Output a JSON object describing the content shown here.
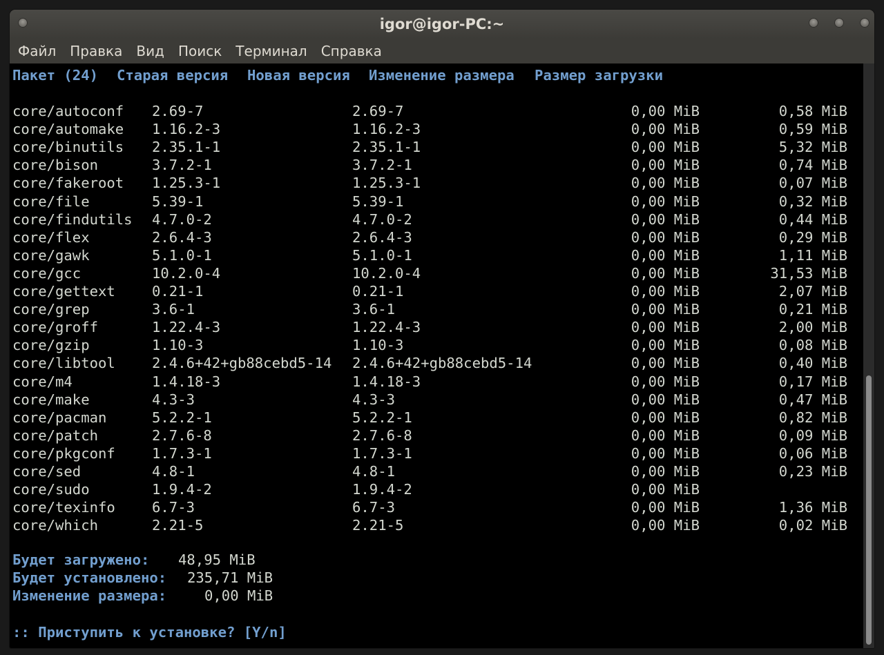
{
  "window": {
    "title": "igor@igor-PC:~"
  },
  "menu": {
    "items": [
      "Файл",
      "Правка",
      "Вид",
      "Поиск",
      "Терминал",
      "Справка"
    ]
  },
  "table": {
    "headers": {
      "package": "Пакет (24)",
      "old_version": "Старая версия",
      "new_version": "Новая версия",
      "size_change": "Изменение размера",
      "download_size": "Размер загрузки"
    },
    "rows": [
      {
        "name": "core/autoconf",
        "old": "2.69-7",
        "new": "2.69-7",
        "change": "0,00 MiB",
        "download": "0,58 MiB"
      },
      {
        "name": "core/automake",
        "old": "1.16.2-3",
        "new": "1.16.2-3",
        "change": "0,00 MiB",
        "download": "0,59 MiB"
      },
      {
        "name": "core/binutils",
        "old": "2.35.1-1",
        "new": "2.35.1-1",
        "change": "0,00 MiB",
        "download": "5,32 MiB"
      },
      {
        "name": "core/bison",
        "old": "3.7.2-1",
        "new": "3.7.2-1",
        "change": "0,00 MiB",
        "download": "0,74 MiB"
      },
      {
        "name": "core/fakeroot",
        "old": "1.25.3-1",
        "new": "1.25.3-1",
        "change": "0,00 MiB",
        "download": "0,07 MiB"
      },
      {
        "name": "core/file",
        "old": "5.39-1",
        "new": "5.39-1",
        "change": "0,00 MiB",
        "download": "0,32 MiB"
      },
      {
        "name": "core/findutils",
        "old": "4.7.0-2",
        "new": "4.7.0-2",
        "change": "0,00 MiB",
        "download": "0,44 MiB"
      },
      {
        "name": "core/flex",
        "old": "2.6.4-3",
        "new": "2.6.4-3",
        "change": "0,00 MiB",
        "download": "0,29 MiB"
      },
      {
        "name": "core/gawk",
        "old": "5.1.0-1",
        "new": "5.1.0-1",
        "change": "0,00 MiB",
        "download": "1,11 MiB"
      },
      {
        "name": "core/gcc",
        "old": "10.2.0-4",
        "new": "10.2.0-4",
        "change": "0,00 MiB",
        "download": "31,53 MiB"
      },
      {
        "name": "core/gettext",
        "old": "0.21-1",
        "new": "0.21-1",
        "change": "0,00 MiB",
        "download": "2,07 MiB"
      },
      {
        "name": "core/grep",
        "old": "3.6-1",
        "new": "3.6-1",
        "change": "0,00 MiB",
        "download": "0,21 MiB"
      },
      {
        "name": "core/groff",
        "old": "1.22.4-3",
        "new": "1.22.4-3",
        "change": "0,00 MiB",
        "download": "2,00 MiB"
      },
      {
        "name": "core/gzip",
        "old": "1.10-3",
        "new": "1.10-3",
        "change": "0,00 MiB",
        "download": "0,08 MiB"
      },
      {
        "name": "core/libtool",
        "old": "2.4.6+42+gb88cebd5-14",
        "new": "2.4.6+42+gb88cebd5-14",
        "change": "0,00 MiB",
        "download": "0,40 MiB"
      },
      {
        "name": "core/m4",
        "old": "1.4.18-3",
        "new": "1.4.18-3",
        "change": "0,00 MiB",
        "download": "0,17 MiB"
      },
      {
        "name": "core/make",
        "old": "4.3-3",
        "new": "4.3-3",
        "change": "0,00 MiB",
        "download": "0,47 MiB"
      },
      {
        "name": "core/pacman",
        "old": "5.2.2-1",
        "new": "5.2.2-1",
        "change": "0,00 MiB",
        "download": "0,82 MiB"
      },
      {
        "name": "core/patch",
        "old": "2.7.6-8",
        "new": "2.7.6-8",
        "change": "0,00 MiB",
        "download": "0,09 MiB"
      },
      {
        "name": "core/pkgconf",
        "old": "1.7.3-1",
        "new": "1.7.3-1",
        "change": "0,00 MiB",
        "download": "0,06 MiB"
      },
      {
        "name": "core/sed",
        "old": "4.8-1",
        "new": "4.8-1",
        "change": "0,00 MiB",
        "download": "0,23 MiB"
      },
      {
        "name": "core/sudo",
        "old": "1.9.4-2",
        "new": "1.9.4-2",
        "change": "0,00 MiB",
        "download": ""
      },
      {
        "name": "core/texinfo",
        "old": "6.7-3",
        "new": "6.7-3",
        "change": "0,00 MiB",
        "download": "1,36 MiB"
      },
      {
        "name": "core/which",
        "old": "2.21-5",
        "new": "2.21-5",
        "change": "0,00 MiB",
        "download": "0,02 MiB"
      }
    ]
  },
  "summary": {
    "download_label": "Будет загружено:",
    "download_value": "48,95 MiB",
    "install_label": "Будет установлено:",
    "install_value": "235,71 MiB",
    "change_label": "Изменение размера:",
    "change_value": "0,00 MiB"
  },
  "prompt": {
    "text": ":: Приступить к установке? [Y/n]"
  }
}
